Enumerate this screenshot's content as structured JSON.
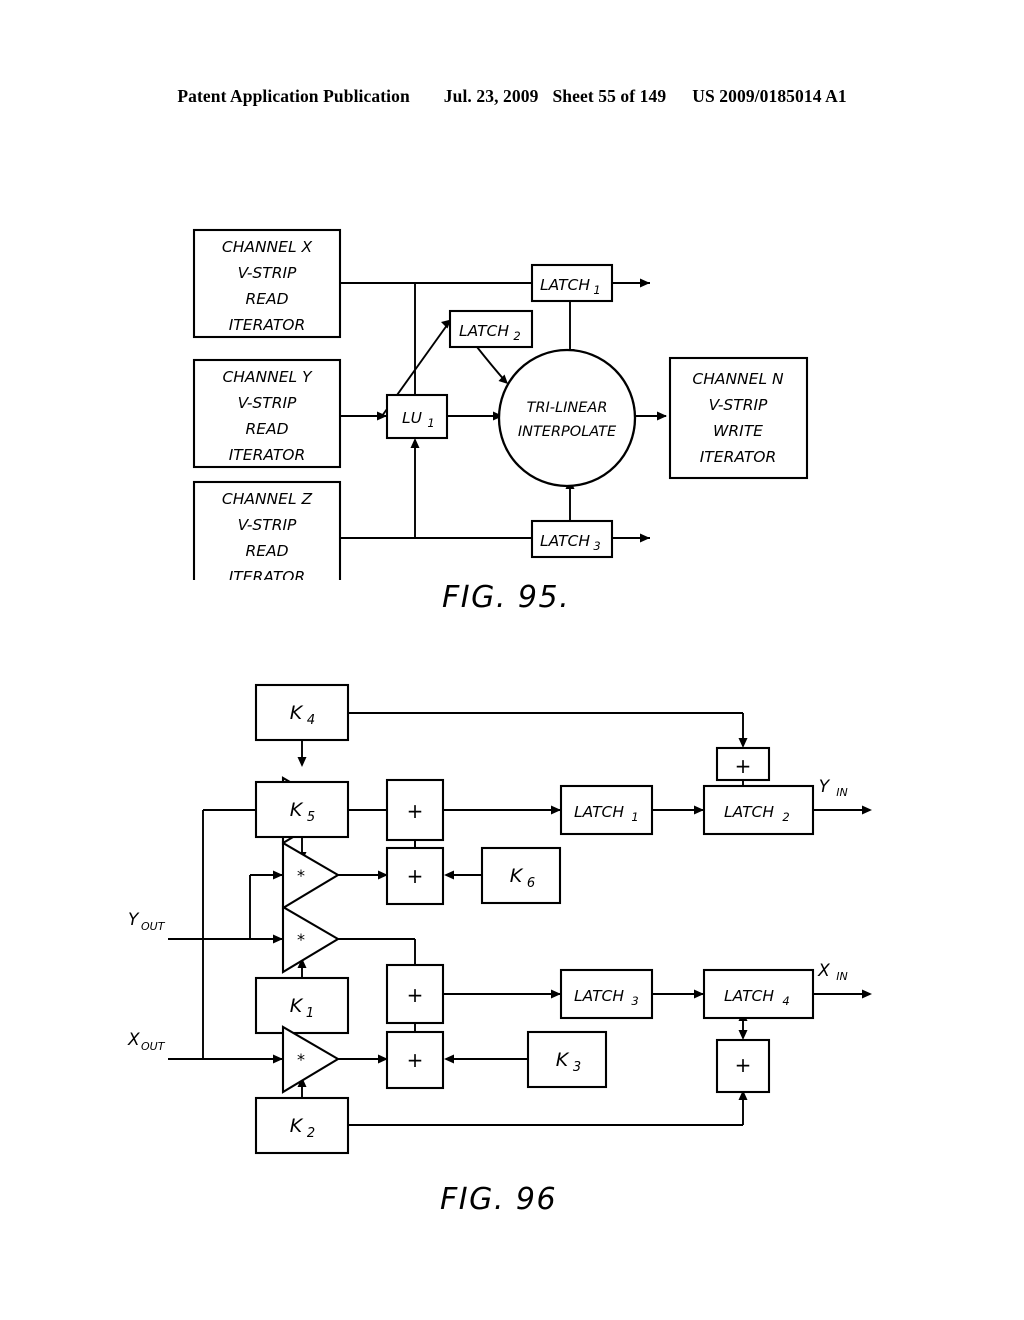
{
  "header": {
    "publication": "Patent Application Publication",
    "date": "Jul. 23, 2009",
    "sheet": "Sheet 55 of 149",
    "docnumber": "US 2009/0185014 A1"
  },
  "figures": [
    {
      "caption": "FIG. 95.",
      "id": "fig-95",
      "blocks": {
        "channel_x": [
          "CHANNEL X",
          "V-STRIP",
          "READ",
          "ITERATOR"
        ],
        "channel_y": [
          "CHANNEL Y",
          "V-STRIP",
          "READ",
          "ITERATOR"
        ],
        "channel_z": [
          "CHANNEL Z",
          "V-STRIP",
          "READ",
          "ITERATOR"
        ],
        "channel_n": [
          "CHANNEL N",
          "V-STRIP",
          "WRITE",
          "ITERATOR"
        ],
        "latch1": {
          "base": "LATCH",
          "sub": "1"
        },
        "latch2": {
          "base": "LATCH",
          "sub": "2"
        },
        "latch3": {
          "base": "LATCH",
          "sub": "3"
        },
        "lu1": {
          "base": "LU",
          "sub": "1"
        },
        "interpolate": [
          "TRI-LINEAR",
          "INTERPOLATE"
        ]
      }
    },
    {
      "caption": "FIG. 96",
      "id": "fig-96",
      "blocks": {
        "k1": {
          "base": "K",
          "sub": "1"
        },
        "k2": {
          "base": "K",
          "sub": "2"
        },
        "k3": {
          "base": "K",
          "sub": "3"
        },
        "k4": {
          "base": "K",
          "sub": "4"
        },
        "k5": {
          "base": "K",
          "sub": "5"
        },
        "k6": {
          "base": "K",
          "sub": "6"
        },
        "latch1": {
          "base": "LATCH",
          "sub": "1"
        },
        "latch2": {
          "base": "LATCH",
          "sub": "2"
        },
        "latch3": {
          "base": "LATCH",
          "sub": "3"
        },
        "latch4": {
          "base": "LATCH",
          "sub": "4"
        },
        "adder_symbol": "+",
        "multiplier_symbol": "*",
        "y_out": {
          "base": "Y",
          "sub": "OUT"
        },
        "x_out": {
          "base": "X",
          "sub": "OUT"
        },
        "y_in": {
          "base": "Y",
          "sub": "IN"
        },
        "x_in": {
          "base": "X",
          "sub": "IN"
        }
      }
    }
  ],
  "colors": {
    "ink": "#000000",
    "paper": "#ffffff"
  }
}
